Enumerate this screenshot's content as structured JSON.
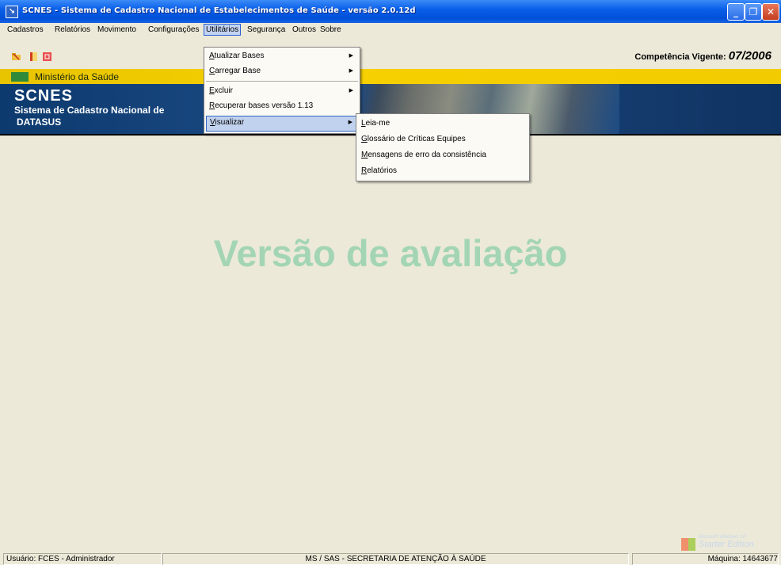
{
  "window": {
    "title": "SCNES - Sistema de Cadastro Nacional de Estabelecimentos de Saúde - versão 2.0.12d",
    "minimize_label": "_",
    "maximize_label": "❐",
    "close_label": "✕"
  },
  "menubar": {
    "items": [
      "Cadastros",
      "Relatórios",
      "Movimento",
      "Configurações",
      "Utilitários",
      "Segurança",
      "Outros",
      "Sobre"
    ],
    "open_item": "Utilitários"
  },
  "toolbar": {
    "competencia_label": "Competência Vigente:",
    "competencia_value": "07/2006"
  },
  "header": {
    "ministerio": "Ministério da Saúde",
    "scnes": "SCNES",
    "sistema": "Sistema de Cadastro Nacional de",
    "datasus": "DATASUS"
  },
  "utilitarios_menu": {
    "items": [
      {
        "label": "Atualizar Bases",
        "accel": "A",
        "rest": "tualizar Bases",
        "submenu": true
      },
      {
        "label": "Carregar Base",
        "accel": "C",
        "rest": "arregar Base",
        "submenu": true
      },
      {
        "label": "Excluir",
        "accel": "E",
        "rest": "xcluir",
        "submenu": true
      },
      {
        "label": "Recuperar bases versão 1.13",
        "accel": "R",
        "rest": "ecuperar bases versão 1.13",
        "submenu": false
      },
      {
        "label": "Visualizar",
        "accel": "V",
        "rest": "isualizar",
        "submenu": true,
        "highlighted": true
      }
    ]
  },
  "visualizar_submenu": {
    "items": [
      {
        "label": "Leia-me",
        "accel": "L",
        "rest": "eia-me"
      },
      {
        "label": "Glossário de Críticas Equipes",
        "accel": "G",
        "rest": "lossário de Críticas Equipes"
      },
      {
        "label": "Mensagens de erro da consistência",
        "accel": "M",
        "rest": "ensagens de erro da consistência"
      },
      {
        "label": "Relatórios",
        "accel": "R",
        "rest": "elatórios"
      }
    ]
  },
  "watermark": "Versão de avaliação",
  "statusbar": {
    "usuario": "Usuário: FCES - Administrador",
    "secretaria": "MS / SAS - SECRETARIA DE ATENÇÃO À SAÚDE",
    "maquina": "Máquina: 14643677"
  },
  "edition": {
    "small": "Microsoft Windows XP",
    "big": "Starter Edition"
  },
  "colors": {
    "titlebar": "#0a5fe8",
    "window_bg": "#ece9d8",
    "ministerio_bar": "#f6d000",
    "banner": "#1c4b85",
    "watermark": "#a3d5b4",
    "menu_highlight": "#c1d2ee"
  }
}
